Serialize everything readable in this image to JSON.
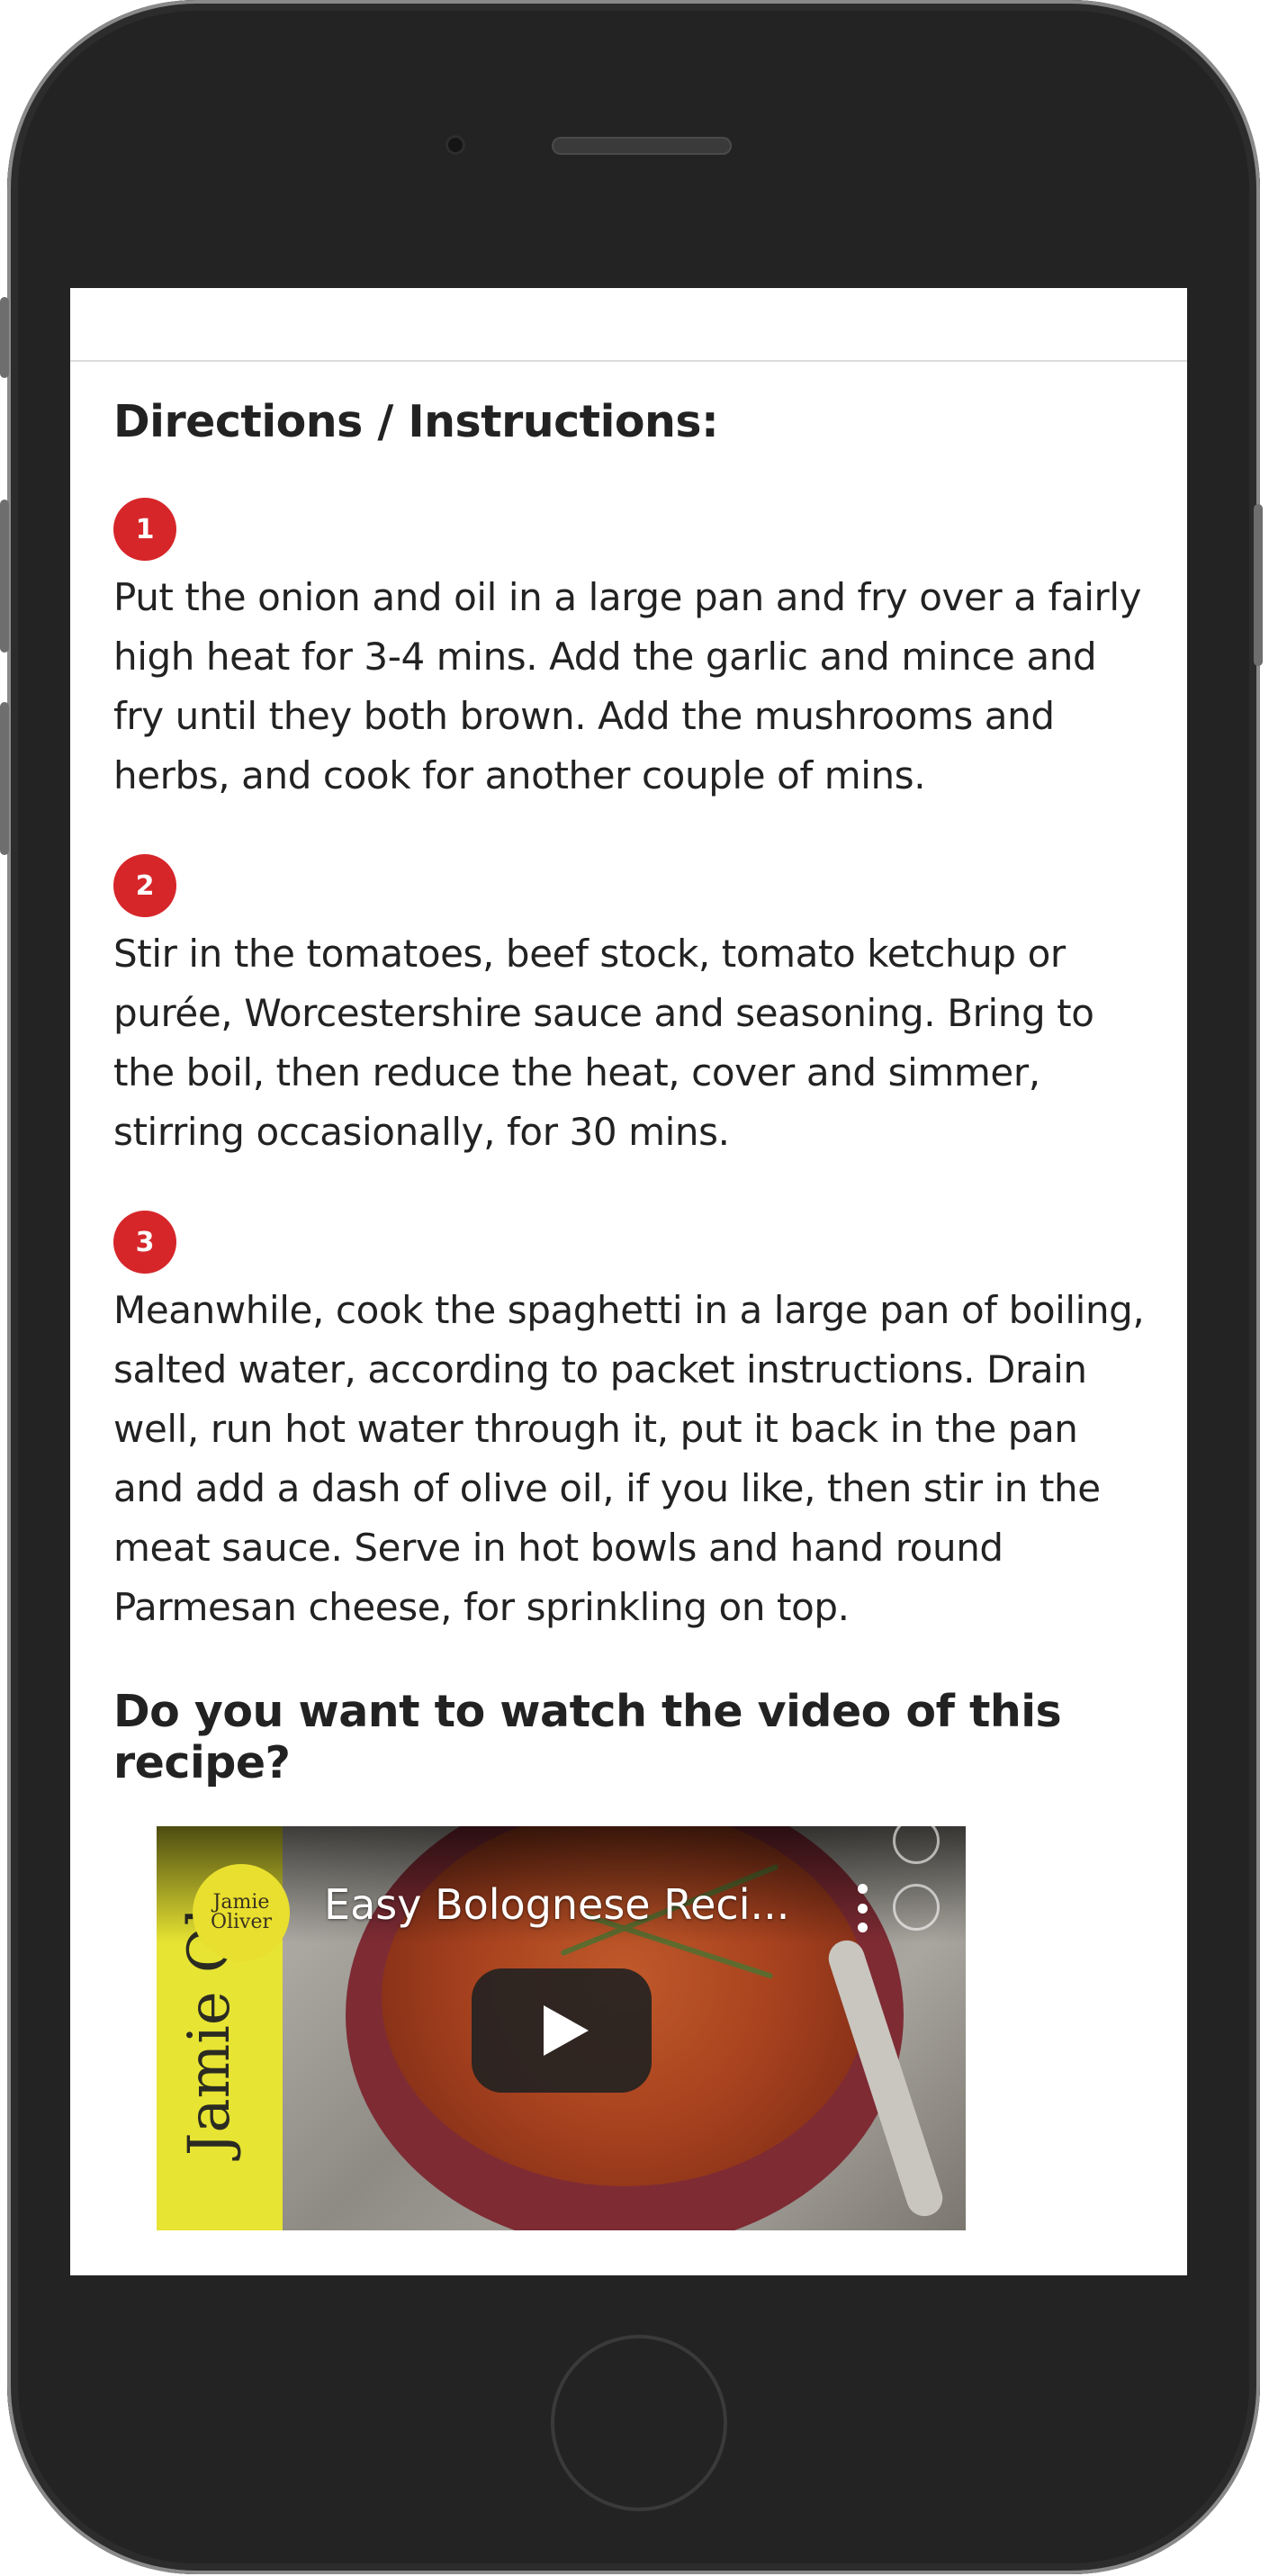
{
  "section": {
    "directions_heading": "Directions / Instructions:"
  },
  "steps": [
    {
      "number": "1",
      "text": "Put the onion and oil in a large pan and fry over a fairly high heat for 3-4 mins. Add the garlic and mince and fry until they both brown. Add the mushrooms and herbs, and cook for another couple of mins."
    },
    {
      "number": "2",
      "text": "Stir in the tomatoes, beef stock, tomato ketchup or purée, Worcestershire sauce and seasoning. Bring to the boil, then reduce the heat, cover and simmer, stirring occasionally, for 30 mins."
    },
    {
      "number": "3",
      "text": "Meanwhile, cook the spaghetti in a large pan of boiling, salted water, according to packet instructions. Drain well, run hot water through it, put it back in the pan and add a dash of olive oil, if you like, then stir in the meat sauce. Serve in hot bowls and hand round Parmesan cheese, for sprinkling on top."
    }
  ],
  "video_section": {
    "heading": "Do you want to watch the video of this recipe?"
  },
  "video": {
    "title": "Easy Bolognese Reci...",
    "channel_logo_line1": "Jamie",
    "channel_logo_line2": "Oliver",
    "thumbnail_brand_text": "Jamie Ol",
    "play_icon": "play-icon",
    "menu_icon": "kebab-menu-icon"
  },
  "colors": {
    "badge": "#d6262a",
    "phone_body": "#232323",
    "logo_yellow": "#e9df2e"
  }
}
